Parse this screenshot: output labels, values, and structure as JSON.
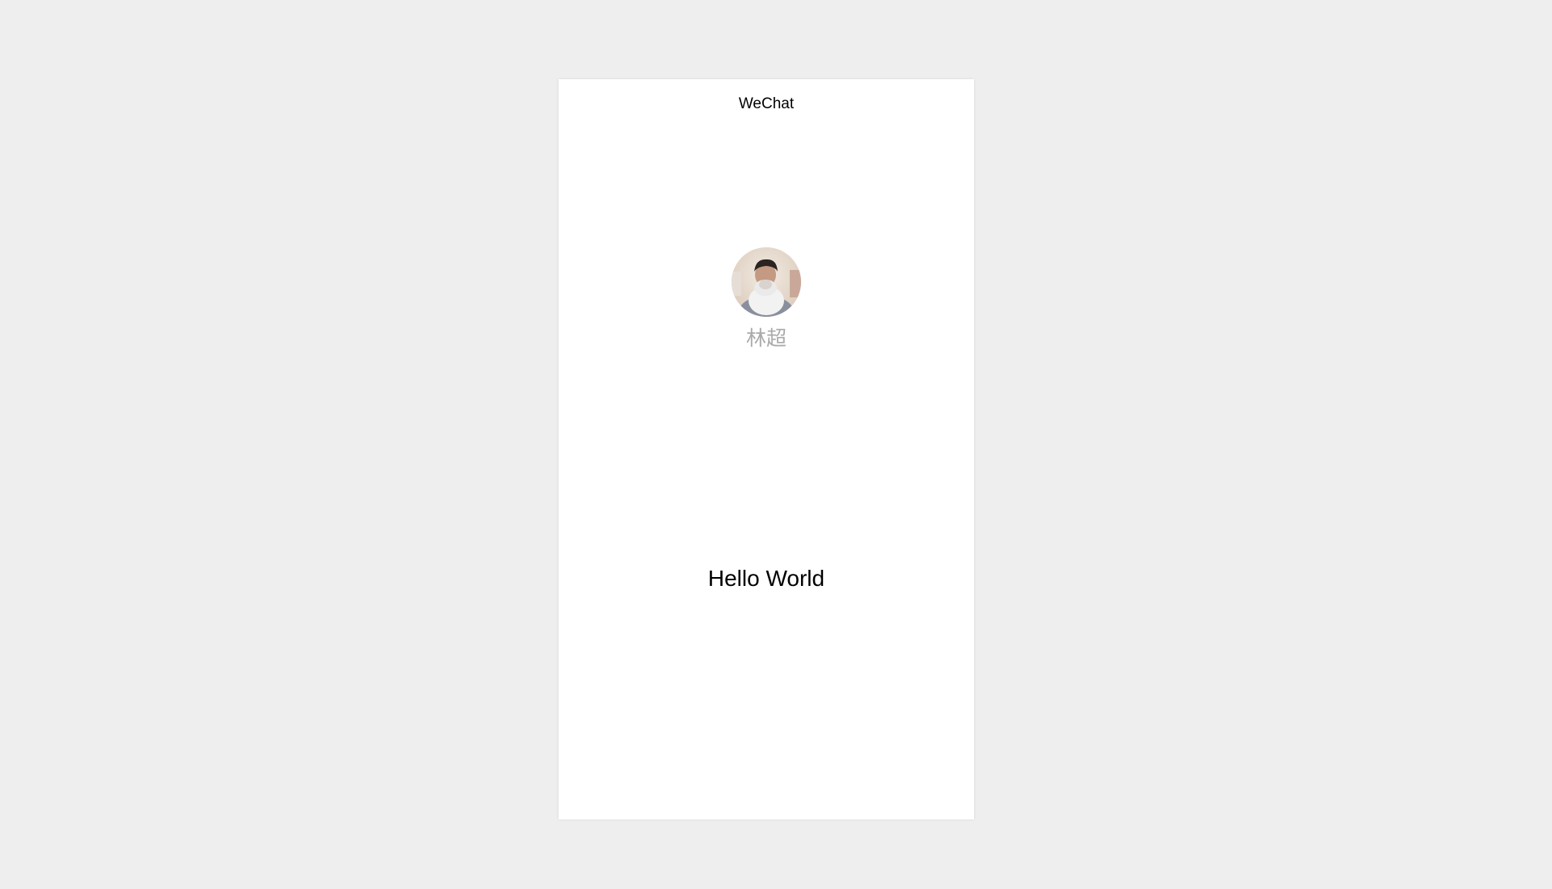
{
  "navigation": {
    "title": "WeChat"
  },
  "user": {
    "avatar_icon": "user-avatar",
    "nickname": "林超"
  },
  "content": {
    "motto": "Hello World"
  },
  "colors": {
    "page_background": "#eeeeee",
    "frame_background": "#ffffff",
    "nickname_text": "#aaaaaa",
    "motto_text": "#000000"
  }
}
